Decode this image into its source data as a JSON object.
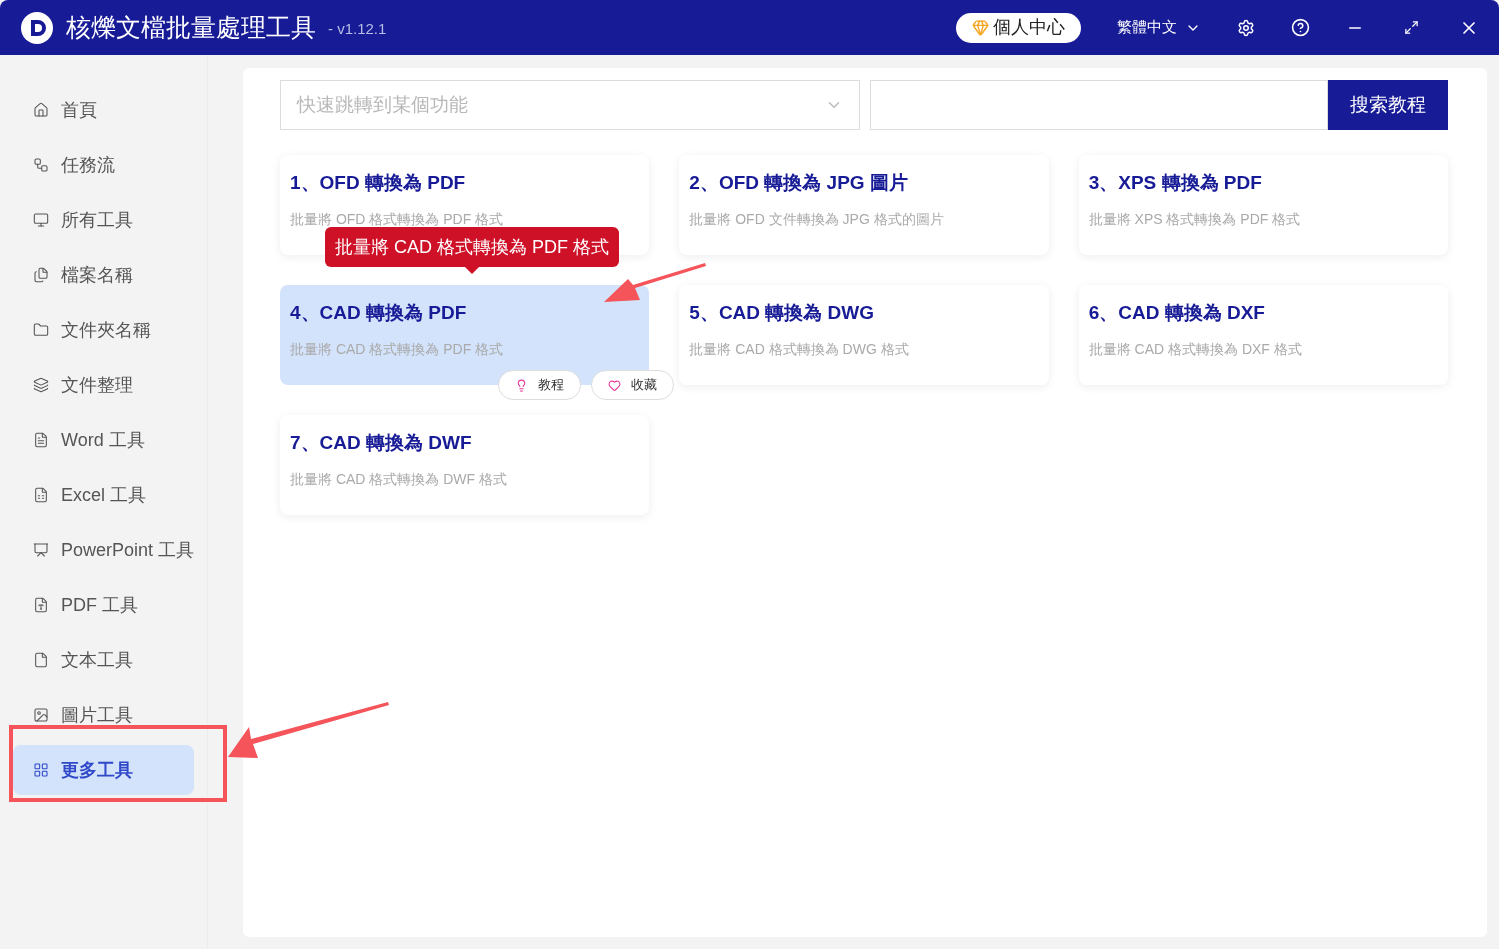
{
  "window": {
    "title": "核爍文檔批量處理工具",
    "version": "- v1.12.1",
    "user_button": "個人中心",
    "language": "繁體中文"
  },
  "sidebar": {
    "items": [
      {
        "label": "首頁",
        "selected": false
      },
      {
        "label": "任務流",
        "selected": false
      },
      {
        "label": "所有工具",
        "selected": false
      },
      {
        "label": "檔案名稱",
        "selected": false
      },
      {
        "label": "文件夾名稱",
        "selected": false
      },
      {
        "label": "文件整理",
        "selected": false
      },
      {
        "label": "Word 工具",
        "selected": false
      },
      {
        "label": "Excel 工具",
        "selected": false
      },
      {
        "label": "PowerPoint 工具",
        "selected": false
      },
      {
        "label": "PDF 工具",
        "selected": false
      },
      {
        "label": "文本工具",
        "selected": false
      },
      {
        "label": "圖片工具",
        "selected": false
      },
      {
        "label": "更多工具",
        "selected": true
      }
    ]
  },
  "search": {
    "placeholder": "快速跳轉到某個功能",
    "button": "搜索教程"
  },
  "cards": [
    {
      "title": "1、OFD 轉換為 PDF",
      "description": "批量將 OFD 格式轉換為 PDF 格式",
      "hovered": false
    },
    {
      "title": "2、OFD 轉換為 JPG 圖片",
      "description": "批量將 OFD 文件轉換為 JPG 格式的圖片",
      "hovered": false
    },
    {
      "title": "3、XPS 轉換為 PDF",
      "description": "批量將 XPS 格式轉換為 PDF 格式",
      "hovered": false
    },
    {
      "title": "4、CAD 轉換為 PDF",
      "description": "批量將 CAD 格式轉換為 PDF 格式",
      "hovered": true,
      "tooltip": "批量將 CAD 格式轉換為 PDF 格式",
      "actions": [
        "教程",
        "收藏"
      ]
    },
    {
      "title": "5、CAD 轉換為 DWG",
      "description": "批量將 CAD 格式轉換為 DWG 格式",
      "hovered": false
    },
    {
      "title": "6、CAD 轉換為 DXF",
      "description": "批量將 CAD 格式轉換為 DXF 格式",
      "hovered": false
    },
    {
      "title": "7、CAD 轉換為 DWF",
      "description": "批量將 CAD 格式轉換為 DWF 格式",
      "hovered": false
    }
  ]
}
